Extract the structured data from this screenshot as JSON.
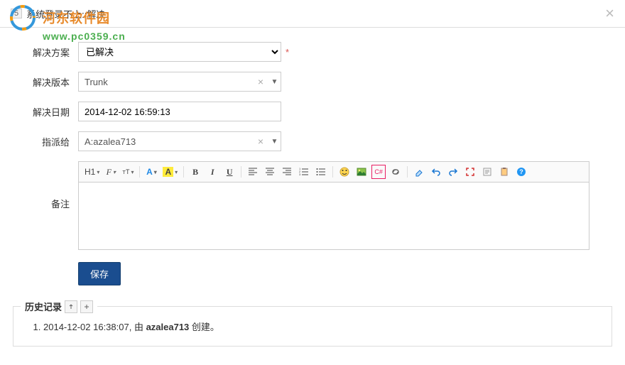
{
  "modal": {
    "bug_id": "5",
    "title": "系统登录不上::解决",
    "close_label": "×"
  },
  "watermark": {
    "site_name": "河东软件园",
    "url": "www.pc0359.cn"
  },
  "form": {
    "resolution": {
      "label": "解决方案",
      "value": "已解决"
    },
    "resolved_build": {
      "label": "解决版本",
      "value": "Trunk"
    },
    "resolved_date": {
      "label": "解决日期",
      "value": "2014-12-02 16:59:13"
    },
    "assigned_to": {
      "label": "指派给",
      "value": "A:azalea713"
    },
    "remark": {
      "label": "备注",
      "value": ""
    },
    "save_btn": "保存"
  },
  "toolbar": {
    "heading": "H1",
    "fontfamily": "F",
    "fontsize": "T",
    "forecolor": "A",
    "hilite": "A",
    "bold": "B",
    "italic": "I",
    "underline": "U"
  },
  "history": {
    "title": "历史记录",
    "items": [
      {
        "time": "2014-12-02 16:38:07",
        "by_prefix": ", 由 ",
        "user": "azalea713",
        "action": " 创建。"
      }
    ]
  }
}
